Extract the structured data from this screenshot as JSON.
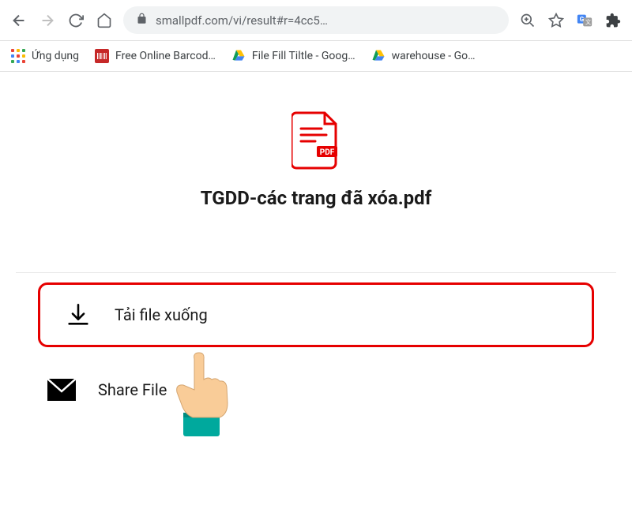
{
  "address_bar": {
    "url": "smallpdf.com/vi/result#r=4cc5…"
  },
  "bookmarks": {
    "apps": "Ứng dụng",
    "barcode": "Free Online Barcod…",
    "filefill": "File Fill Tiltle - Goog…",
    "warehouse": "warehouse - Go…"
  },
  "file": {
    "name": "TGDD-các trang đã xóa.pdf"
  },
  "actions": {
    "download": "Tải file xuống",
    "share": "Share File"
  }
}
